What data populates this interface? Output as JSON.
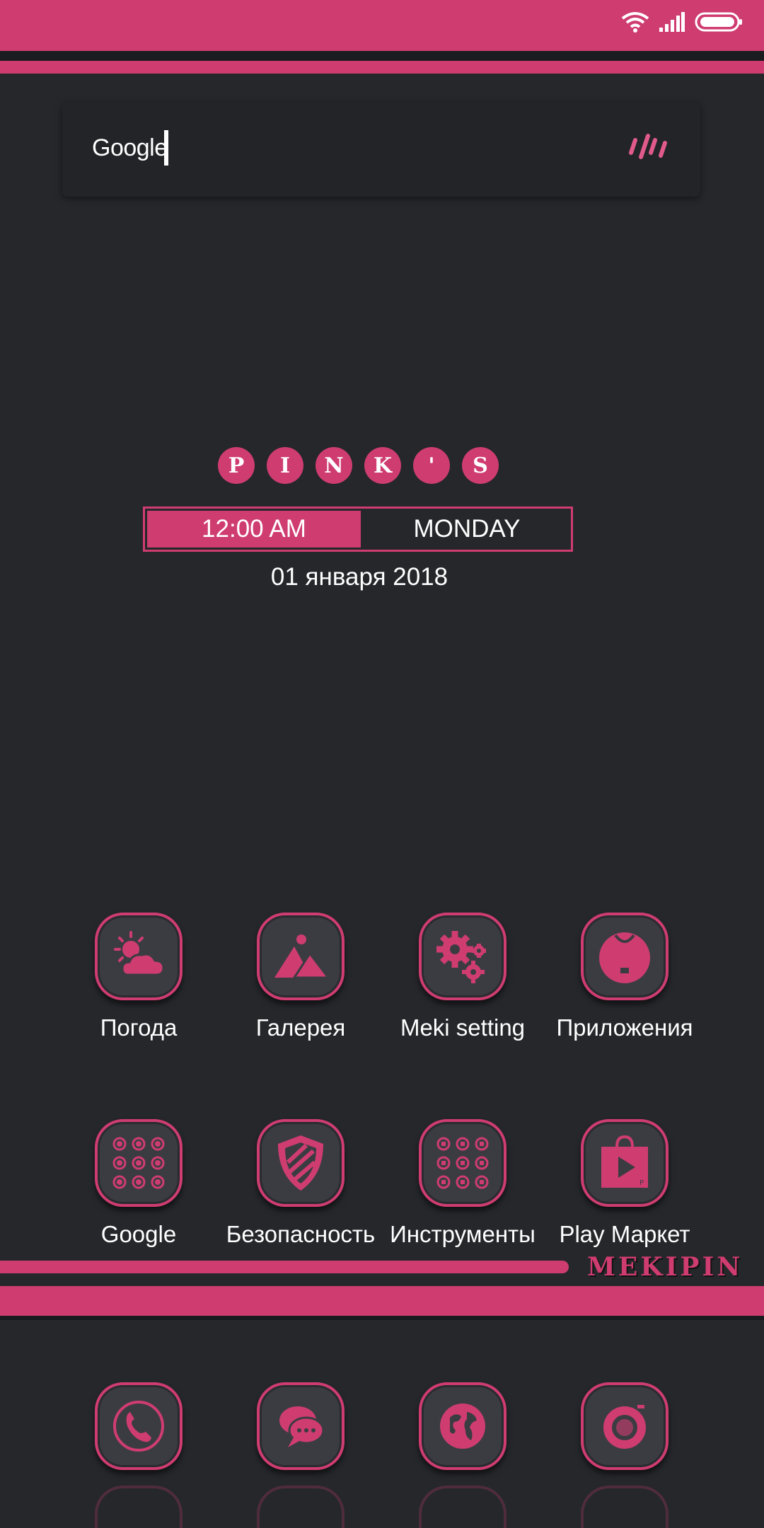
{
  "colors": {
    "accent": "#cf3c70",
    "background": "#25272b"
  },
  "status_bar": {
    "icons": [
      "wifi-icon",
      "signal-icon",
      "battery-icon"
    ]
  },
  "search": {
    "label": "Google",
    "mic_icon": "mic-icon"
  },
  "clock": {
    "letters": [
      "P",
      "I",
      "N",
      "K",
      "'",
      "S"
    ],
    "time": "12:00 AM",
    "day": "MONDAY",
    "date": "01 января 2018"
  },
  "apps": [
    {
      "label": "Погода",
      "icon": "weather-icon"
    },
    {
      "label": "Галерея",
      "icon": "gallery-icon"
    },
    {
      "label": "Meki setting",
      "icon": "settings-gears-icon"
    },
    {
      "label": "Приложения",
      "icon": "apps-bag-icon"
    },
    {
      "label": "Google",
      "icon": "google-folder-icon"
    },
    {
      "label": "Безопасность",
      "icon": "security-shield-icon"
    },
    {
      "label": "Инструменты",
      "icon": "tools-folder-icon"
    },
    {
      "label": "Play Маркет",
      "icon": "play-market-icon"
    }
  ],
  "brand": {
    "text": "MEKIPIN"
  },
  "dock": [
    {
      "icon": "phone-icon"
    },
    {
      "icon": "messages-icon"
    },
    {
      "icon": "browser-globe-icon"
    },
    {
      "icon": "camera-icon"
    }
  ]
}
